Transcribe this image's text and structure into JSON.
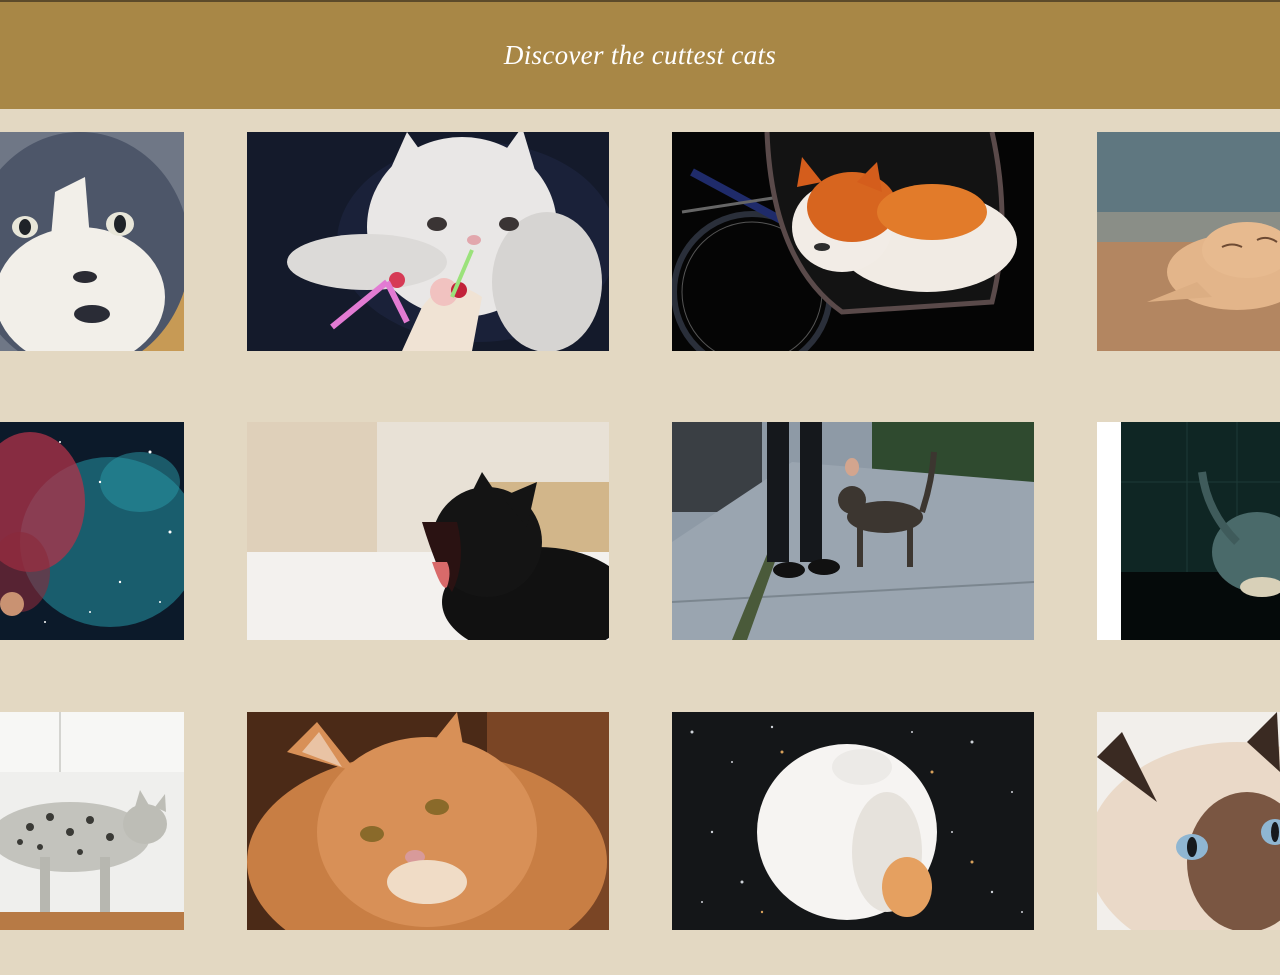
{
  "header": {
    "title": "Discover the cuttest cats",
    "background": "#a88746"
  },
  "page": {
    "background": "#e3d8c2"
  },
  "gallery": {
    "rows": 3,
    "columns": 4,
    "tiles": [
      {
        "subject": "gray-white-cat-face"
      },
      {
        "subject": "white-kitten-milkshake"
      },
      {
        "subject": "orange-white-cat-bicycle-bag"
      },
      {
        "subject": "ginger-cat-sleeping"
      },
      {
        "subject": "cat-in-space-nebula"
      },
      {
        "subject": "black-cat-yawning"
      },
      {
        "subject": "cat-on-sidewalk-petted"
      },
      {
        "subject": "dark-cat-dim-room"
      },
      {
        "subject": "spotted-cat-walking"
      },
      {
        "subject": "fluffy-orange-maine-coon"
      },
      {
        "subject": "white-cat-curled-in-space"
      },
      {
        "subject": "siamese-cat-blue-eyes"
      }
    ]
  }
}
